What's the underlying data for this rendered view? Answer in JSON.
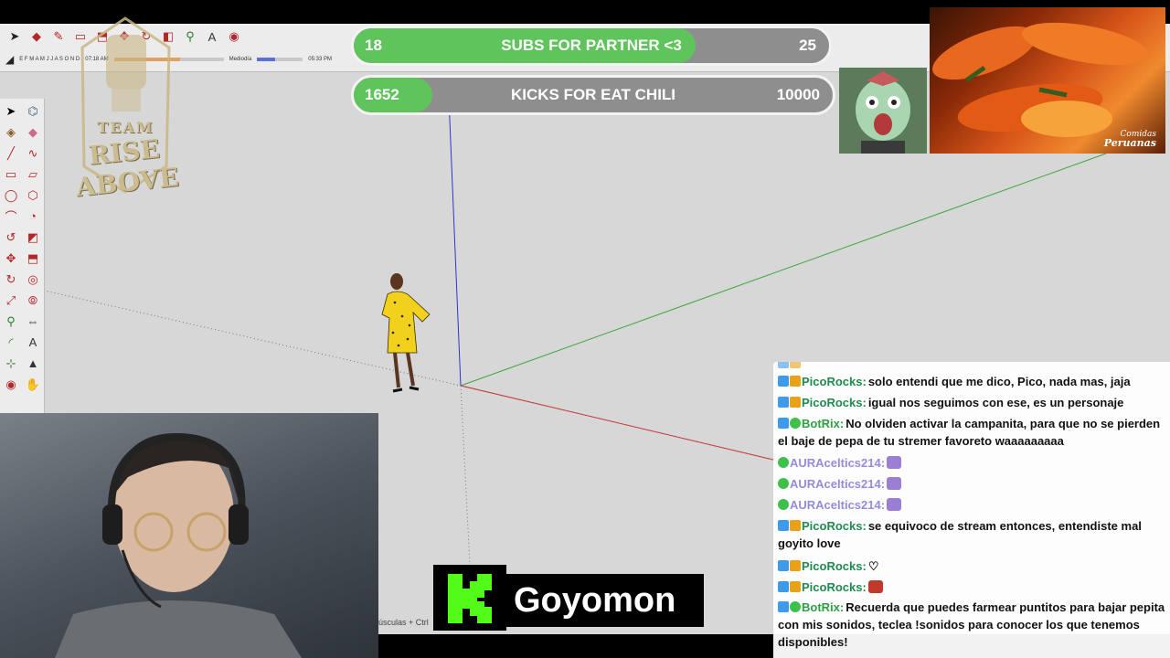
{
  "goals": {
    "subs": {
      "current": "18",
      "label": "SUBS FOR PARTNER <3",
      "target": "25",
      "progress": 0.72
    },
    "kicks": {
      "current": "1652",
      "label": "KICKS FOR EAT CHILI",
      "target": "10000",
      "progress": 0.165
    }
  },
  "team_logo": {
    "line1": "TEAM",
    "line2": "RISE ABOVE"
  },
  "sketchup": {
    "months": "E F M A M J J A S O N D",
    "time_start": "07:18 AM",
    "time_mid": "Mediodía",
    "time_end": "05:33 PM",
    "status_text": "úsculas + Ctrl"
  },
  "food_caption": {
    "line1": "Comidas",
    "line2": "Peruanas"
  },
  "kick": {
    "streamer": "Goyomon",
    "logo_letter": "K",
    "brand_color": "#53fc18"
  },
  "chat": {
    "messages": [
      {
        "badges": [
          "kick-badge",
          "crown-badge"
        ],
        "user": "PicoRocks:",
        "type": "pico",
        "text": "solo entendi que me dico, Pico, nada mas, jaja"
      },
      {
        "badges": [
          "kick-badge",
          "crown-badge"
        ],
        "user": "PicoRocks:",
        "type": "pico",
        "text": "igual nos seguimos con ese, es un personaje"
      },
      {
        "badges": [
          "kick-badge",
          "bot-badge"
        ],
        "user": "BotRix:",
        "type": "bot",
        "text": "No olviden activar la campanita, para que no se pierden el baje de pepa de tu stremer favoreto waaaaaaaaa"
      },
      {
        "badges": [
          "bot-badge"
        ],
        "user": "AURAceltics214:",
        "type": "aura",
        "text": ""
      },
      {
        "badges": [
          "bot-badge"
        ],
        "user": "AURAceltics214:",
        "type": "aura",
        "text": ""
      },
      {
        "badges": [
          "bot-badge"
        ],
        "user": "AURAceltics214:",
        "type": "aura",
        "text": ""
      },
      {
        "badges": [
          "kick-badge",
          "crown-badge"
        ],
        "user": "PicoRocks:",
        "type": "pico",
        "text": "se equivoco de stream entonces, entendiste mal goyito love"
      },
      {
        "badges": [
          "kick-badge",
          "crown-badge"
        ],
        "user": "PicoRocks:",
        "type": "pico",
        "text": "♡"
      },
      {
        "badges": [
          "kick-badge",
          "crown-badge"
        ],
        "user": "PicoRocks:",
        "type": "pico",
        "text": ""
      },
      {
        "badges": [
          "kick-badge",
          "bot-badge"
        ],
        "user": "BotRix:",
        "type": "bot",
        "text": "Recuerda que puedes farmear puntitos para bajar pepita con mis sonidos, teclea !sonidos para conocer los que tenemos disponibles!"
      }
    ]
  }
}
